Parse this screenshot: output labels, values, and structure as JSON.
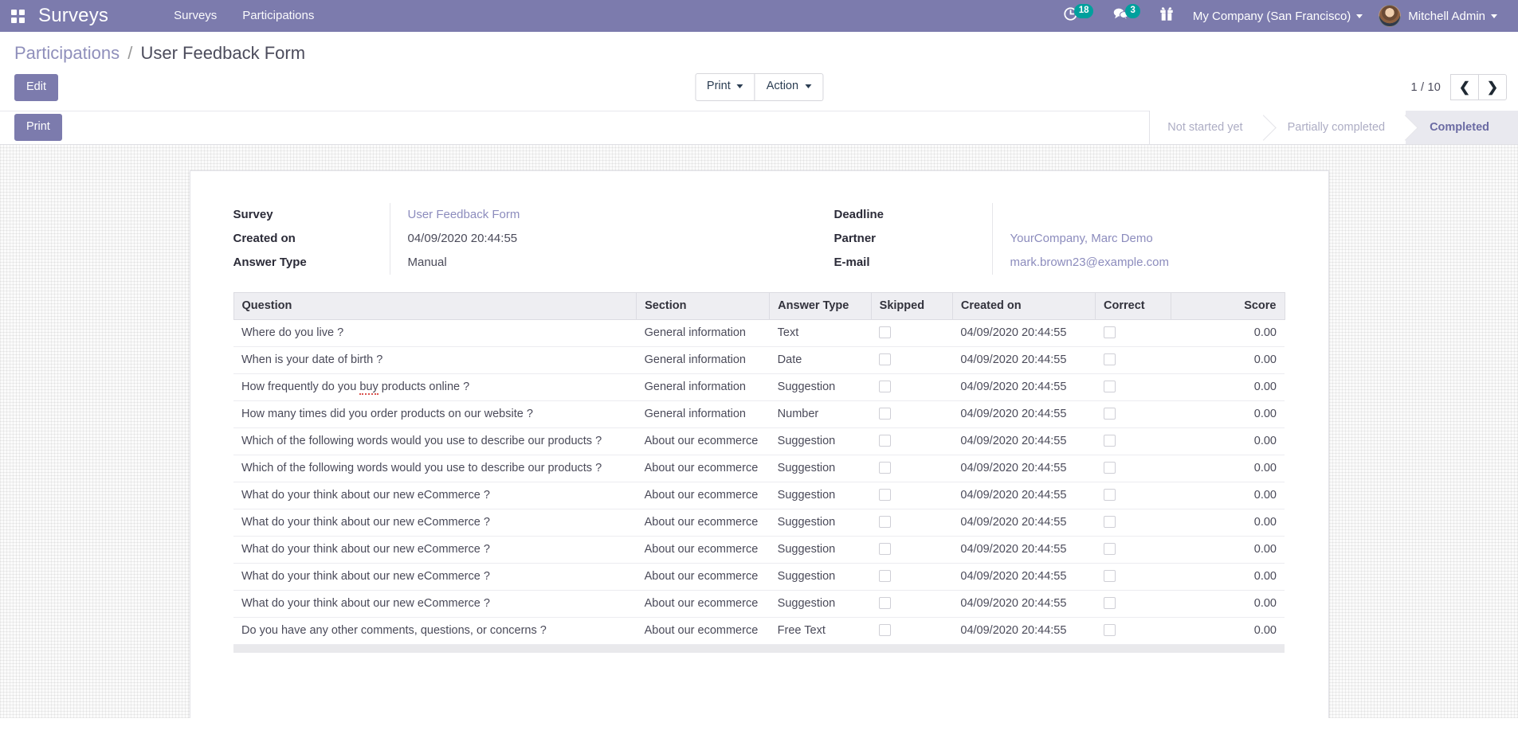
{
  "navbar": {
    "apps_icon": "apps-grid-icon",
    "brand": "Surveys",
    "menu": [
      {
        "label": "Surveys"
      },
      {
        "label": "Participations"
      }
    ],
    "activities": {
      "icon": "clock-activity-icon",
      "count": "18"
    },
    "messages": {
      "icon": "chat-bubbles-icon",
      "count": "3"
    },
    "gift": {
      "icon": "gift-icon"
    },
    "company": "My Company (San Francisco)",
    "user": "Mitchell Admin"
  },
  "breadcrumb": {
    "parent": "Participations",
    "separator": "/",
    "current": "User Feedback Form"
  },
  "control_panel": {
    "edit_label": "Edit",
    "print_label": "Print",
    "action_label": "Action",
    "pager": "1 / 10",
    "prev_icon": "chevron-left-icon",
    "next_icon": "chevron-right-icon"
  },
  "statusbar": {
    "print_button": "Print",
    "stages": [
      {
        "label": "Not started yet",
        "active": false
      },
      {
        "label": "Partially completed",
        "active": false
      },
      {
        "label": "Completed",
        "active": true
      }
    ]
  },
  "form": {
    "left": [
      {
        "label": "Survey",
        "value": "User Feedback Form",
        "is_link": true
      },
      {
        "label": "Created on",
        "value": "04/09/2020 20:44:55",
        "is_link": false
      },
      {
        "label": "Answer Type",
        "value": "Manual",
        "is_link": false
      }
    ],
    "right": [
      {
        "label": "Deadline",
        "value": "",
        "is_link": false
      },
      {
        "label": "Partner",
        "value": "YourCompany, Marc Demo",
        "is_link": true
      },
      {
        "label": "E-mail",
        "value": "mark.brown23@example.com",
        "is_link": true
      }
    ]
  },
  "table": {
    "columns": [
      "Question",
      "Section",
      "Answer Type",
      "Skipped",
      "Created on",
      "Correct",
      "Score"
    ],
    "rows": [
      {
        "question": "Where do you live ?",
        "section": "General information",
        "answer_type": "Text",
        "skipped": false,
        "created_on": "04/09/2020 20:44:55",
        "correct": false,
        "score": "0.00"
      },
      {
        "question": "When is your date of birth ?",
        "section": "General information",
        "answer_type": "Date",
        "skipped": false,
        "created_on": "04/09/2020 20:44:55",
        "correct": false,
        "score": "0.00"
      },
      {
        "question": "How frequently do you buy products online ?",
        "section": "General information",
        "answer_type": "Suggestion",
        "skipped": false,
        "created_on": "04/09/2020 20:44:55",
        "correct": false,
        "score": "0.00"
      },
      {
        "question": "How many times did you order products on our website ?",
        "section": "General information",
        "answer_type": "Number",
        "skipped": false,
        "created_on": "04/09/2020 20:44:55",
        "correct": false,
        "score": "0.00"
      },
      {
        "question": "Which of the following words would you use to describe our products ?",
        "section": "About our ecommerce",
        "answer_type": "Suggestion",
        "skipped": false,
        "created_on": "04/09/2020 20:44:55",
        "correct": false,
        "score": "0.00"
      },
      {
        "question": "Which of the following words would you use to describe our products ?",
        "section": "About our ecommerce",
        "answer_type": "Suggestion",
        "skipped": false,
        "created_on": "04/09/2020 20:44:55",
        "correct": false,
        "score": "0.00"
      },
      {
        "question": "What do your think about our new eCommerce ?",
        "section": "About our ecommerce",
        "answer_type": "Suggestion",
        "skipped": false,
        "created_on": "04/09/2020 20:44:55",
        "correct": false,
        "score": "0.00"
      },
      {
        "question": "What do your think about our new eCommerce ?",
        "section": "About our ecommerce",
        "answer_type": "Suggestion",
        "skipped": false,
        "created_on": "04/09/2020 20:44:55",
        "correct": false,
        "score": "0.00"
      },
      {
        "question": "What do your think about our new eCommerce ?",
        "section": "About our ecommerce",
        "answer_type": "Suggestion",
        "skipped": false,
        "created_on": "04/09/2020 20:44:55",
        "correct": false,
        "score": "0.00"
      },
      {
        "question": "What do your think about our new eCommerce ?",
        "section": "About our ecommerce",
        "answer_type": "Suggestion",
        "skipped": false,
        "created_on": "04/09/2020 20:44:55",
        "correct": false,
        "score": "0.00"
      },
      {
        "question": "What do your think about our new eCommerce ?",
        "section": "About our ecommerce",
        "answer_type": "Suggestion",
        "skipped": false,
        "created_on": "04/09/2020 20:44:55",
        "correct": false,
        "score": "0.00"
      },
      {
        "question": "Do you have any other comments, questions, or concerns ?",
        "section": "About our ecommerce",
        "answer_type": "Free Text",
        "skipped": false,
        "created_on": "04/09/2020 20:44:55",
        "correct": false,
        "score": "0.00"
      }
    ]
  },
  "colors": {
    "brand_purple": "#7C7BAD",
    "badge_teal": "#00A09D",
    "link_purple": "#8C8CBD"
  }
}
